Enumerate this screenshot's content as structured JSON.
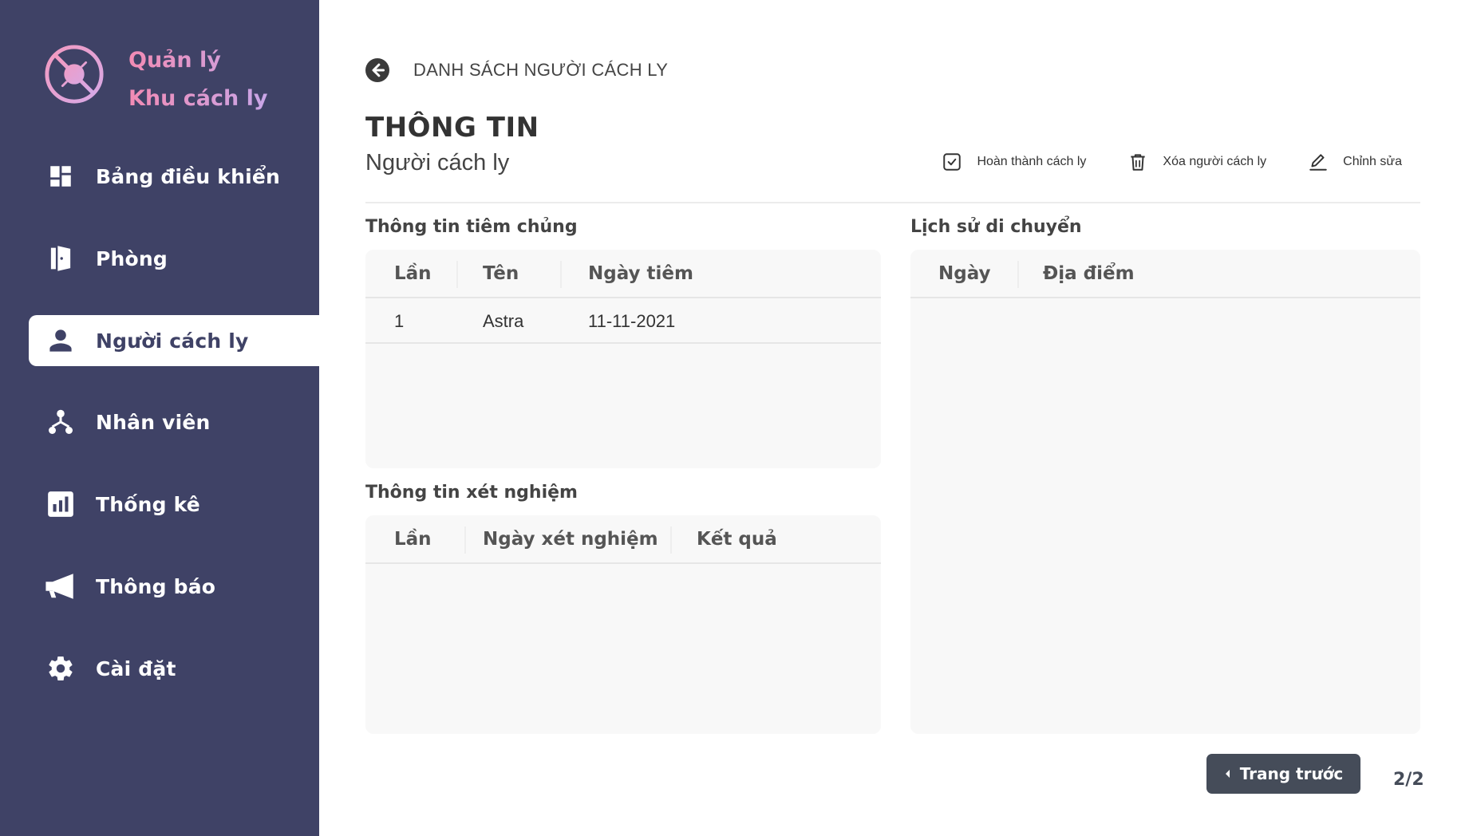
{
  "brand": {
    "line1": "Quản lý",
    "line2": "Khu cách ly",
    "logo_icon": "virus-prohibited-icon",
    "gradient": [
      "#f28bb4",
      "#c9a6e8"
    ]
  },
  "sidebar": {
    "background": "#3f4266",
    "items": [
      {
        "label": "Bảng điều khiển",
        "icon": "dashboard-icon",
        "active": false
      },
      {
        "label": "Phòng",
        "icon": "door-icon",
        "active": false
      },
      {
        "label": "Người cách ly",
        "icon": "person-icon",
        "active": true
      },
      {
        "label": "Nhân viên",
        "icon": "staff-hierarchy-icon",
        "active": false
      },
      {
        "label": "Thống kê",
        "icon": "bar-chart-icon",
        "active": false
      },
      {
        "label": "Thông báo",
        "icon": "megaphone-icon",
        "active": false
      },
      {
        "label": "Cài đặt",
        "icon": "gear-icon",
        "active": false
      }
    ]
  },
  "header": {
    "breadcrumb": "DANH SÁCH NGƯỜI CÁCH LY",
    "title": "THÔNG TIN",
    "subtitle": "Người cách ly"
  },
  "actions": {
    "complete": "Hoàn thành cách ly",
    "delete": "Xóa người cách ly",
    "edit": "Chỉnh sửa"
  },
  "vaccination": {
    "title": "Thông tin tiêm chủng",
    "columns": [
      "Lần",
      "Tên",
      "Ngày tiêm"
    ],
    "rows": [
      [
        "1",
        "Astra",
        "11-11-2021"
      ]
    ]
  },
  "testing": {
    "title": "Thông tin xét nghiệm",
    "columns": [
      "Lần",
      "Ngày xét nghiệm",
      "Kết quả"
    ],
    "rows": []
  },
  "movement": {
    "title": "Lịch sử di chuyển",
    "columns": [
      "Ngày",
      "Địa điểm"
    ],
    "rows": []
  },
  "pagination": {
    "prev_label": "Trang trước",
    "page_indicator": "2/2"
  }
}
